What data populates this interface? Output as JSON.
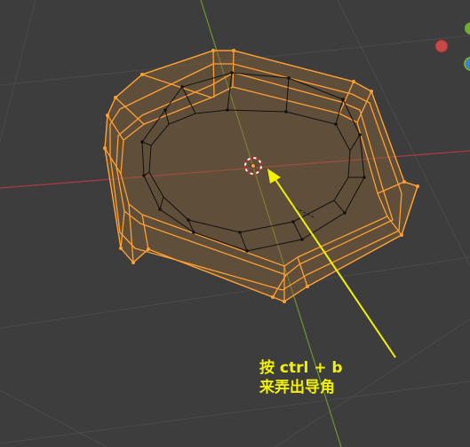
{
  "viewport": {
    "background": "#3d3d3d",
    "grid_color": "#4a4a4a",
    "x_axis_color": "#a33c44",
    "y_axis_color": "#6c8e30",
    "mesh_fill": "#8a6436",
    "mesh_edge_selected": "#ffa033",
    "mesh_edge_unselected": "#000000"
  },
  "annotation": {
    "color": "#f2f200",
    "line1": "按 ctrl + b",
    "line2": "来弄出导角"
  },
  "gizmo": {
    "x_dot_color": "#c64a4a",
    "y_dot_color": "#6dae2e",
    "z_dot_color": "#3f7dd8"
  },
  "icons": {
    "origin": "object-origin-icon",
    "cursor": "3d-cursor-icon",
    "arrow": "annotation-arrow-icon"
  }
}
